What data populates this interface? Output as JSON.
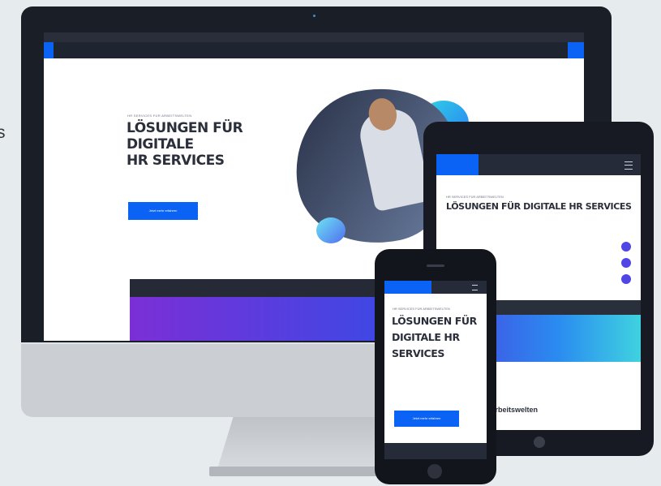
{
  "edge_text": "s",
  "desktop": {
    "eyebrow": "HR SERVICES FÜR ARBEITSWELTEN",
    "title_line1": "LÖSUNGEN FÜR DIGITALE",
    "title_line2": "HR SERVICES",
    "cta_label": "Jetzt mehr erfahren"
  },
  "tablet": {
    "eyebrow": "HR SERVICES FÜR ARBEITSWELTEN",
    "title": "LÖSUNGEN FÜR DIGITALE HR SERVICES",
    "section_heading": "Arbeitswelten"
  },
  "phone": {
    "eyebrow": "HR SERVICES FÜR ARBEITSWELTEN",
    "title": "LÖSUNGEN FÜR DIGITALE HR SERVICES",
    "cta_label": "Jetzt mehr erfahren"
  },
  "colors": {
    "brand_blue": "#0b63f6",
    "dark_nav": "#1f2431",
    "gradient_start": "#7b2fd6",
    "gradient_end": "#2a8cf0"
  }
}
